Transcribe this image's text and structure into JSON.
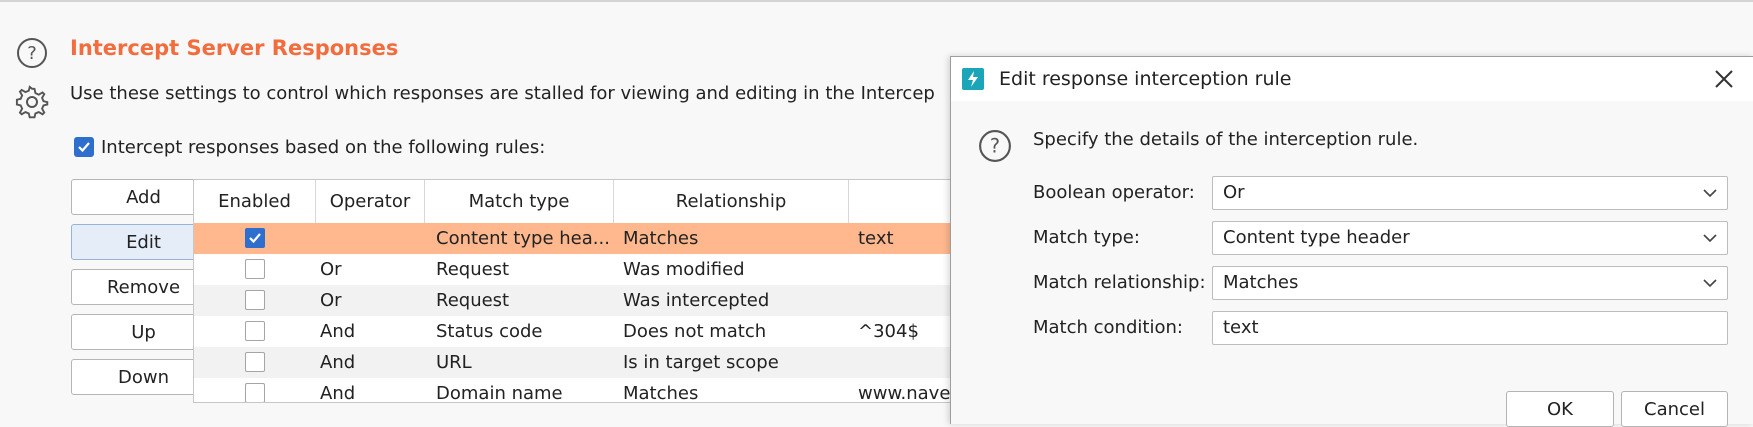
{
  "section": {
    "title": "Intercept Server Responses",
    "description": "Use these settings to control which responses are stalled for viewing and editing in the Intercep"
  },
  "intercept_rules_label": "Intercept responses based on the following rules:",
  "buttons": {
    "add": "Add",
    "edit": "Edit",
    "remove": "Remove",
    "up": "Up",
    "down": "Down"
  },
  "table": {
    "headers": [
      "Enabled",
      "Operator",
      "Match type",
      "Relationship",
      ""
    ],
    "rows": [
      {
        "operator": "",
        "match_type": "Content type hea...",
        "relationship": "Matches",
        "condition": "text"
      },
      {
        "operator": "Or",
        "match_type": "Request",
        "relationship": "Was modified",
        "condition": ""
      },
      {
        "operator": "Or",
        "match_type": "Request",
        "relationship": "Was intercepted",
        "condition": ""
      },
      {
        "operator": "And",
        "match_type": "Status code",
        "relationship": "Does not match",
        "condition": "^304$"
      },
      {
        "operator": "And",
        "match_type": "URL",
        "relationship": "Is in target scope",
        "condition": ""
      },
      {
        "operator": "And",
        "match_type": "Domain name",
        "relationship": "Matches",
        "condition": "www.nave"
      }
    ]
  },
  "dialog": {
    "title": "Edit response interception rule",
    "description": "Specify the details of the interception rule.",
    "boolean_operator_label": "Boolean operator:",
    "boolean_operator_value": "Or",
    "match_type_label": "Match type:",
    "match_type_value": "Content type header",
    "match_relationship_label": "Match relationship:",
    "match_relationship_value": "Matches",
    "match_condition_label": "Match condition:",
    "match_condition_value": "text",
    "ok": "OK",
    "cancel": "Cancel"
  },
  "colors": {
    "accent": "#f26d3d",
    "selected_row": "#ffb88e",
    "checkbox": "#2e6fce",
    "app_icon": "#1aa5b8"
  }
}
